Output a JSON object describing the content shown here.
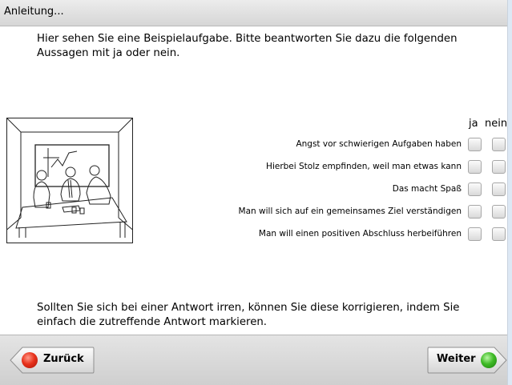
{
  "window": {
    "title": "Anleitung..."
  },
  "instructions": {
    "intro": "Hier sehen Sie eine Beispielaufgabe. Bitte beantworten Sie dazu die folgenden Aussagen mit ja oder nein.",
    "outro": "Sollten Sie sich bei einer Antwort irren, können Sie diese korrigieren, indem Sie einfach die zutreffende Antwort markieren."
  },
  "columns": {
    "yes": "ja",
    "no": "nein"
  },
  "statements": [
    {
      "label": "Angst vor schwierigen Aufgaben haben"
    },
    {
      "label": "Hierbei Stolz empfinden, weil man etwas kann"
    },
    {
      "label": "Das macht Spaß"
    },
    {
      "label": "Man will sich auf ein gemeinsames Ziel verständigen"
    },
    {
      "label": "Man will einen positiven Abschluss herbeiführen"
    }
  ],
  "navigation": {
    "back_label": "Zurück",
    "next_label": "Weiter"
  },
  "colors": {
    "back_indicator": "#e8321c",
    "next_indicator": "#3fbb26",
    "side_background": "#dde8f4"
  }
}
